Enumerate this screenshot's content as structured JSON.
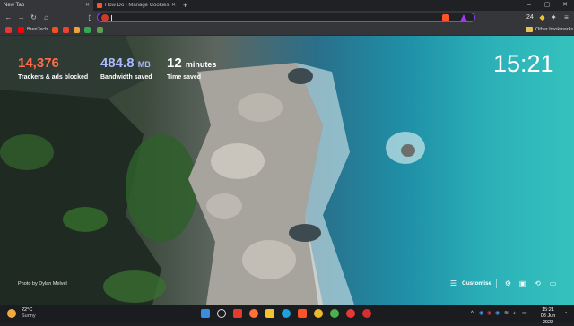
{
  "tabs": [
    {
      "label": "New Tab"
    },
    {
      "label": "How Do I Manage Cookies In Brave?"
    }
  ],
  "toolbar": {
    "extension_badge": "24"
  },
  "bookmarks": {
    "items": [
      {
        "label": "",
        "color": "#e53935"
      },
      {
        "label": "BrenTech",
        "color": "#ff0000"
      }
    ],
    "folder_label": "Other bookmarks"
  },
  "stats": {
    "trackers": {
      "value": "14,376",
      "label": "Trackers & ads blocked",
      "color": "#ff6b4a"
    },
    "bandwidth": {
      "value": "484.8",
      "unit": "MB",
      "label": "Bandwidth saved",
      "color": "#a9b8ff"
    },
    "time": {
      "value": "12",
      "unit": "minutes",
      "label": "Time saved",
      "color": "#ffffff"
    }
  },
  "clock": "15:21",
  "photo_credit": "Photo by Dylan Melvel",
  "customise_label": "Customise",
  "weather": {
    "temp": "22°C",
    "desc": "Sunny"
  },
  "system": {
    "time": "15:21",
    "date": "08 Jun 2022",
    "lang": "ENG"
  },
  "colors": {
    "accent": "#8a3ffc",
    "brave": "#fb542b"
  }
}
